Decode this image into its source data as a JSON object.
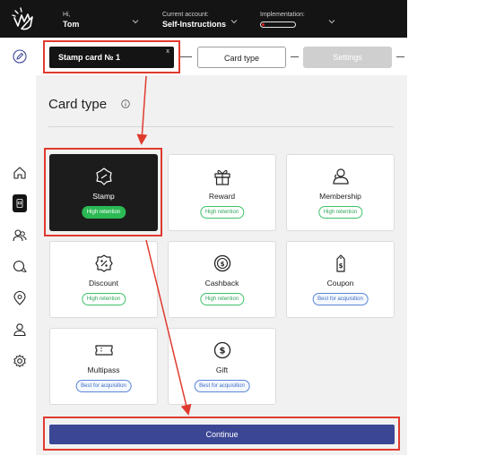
{
  "header": {
    "greeting_small": "Hi,",
    "user_name": "Tom",
    "account_label": "Current account:",
    "account_value": "Self-Instructions",
    "implementation_label": "Implementation:",
    "implementation_progress": 0.05
  },
  "subheader": {
    "card_name": "Stamp card № 1",
    "close_symbol": "x",
    "steps": [
      "Card type",
      "Settings"
    ]
  },
  "page": {
    "title": "Card type"
  },
  "cards": [
    {
      "name": "Stamp",
      "badge": "High retention",
      "badge_type": "green",
      "selected": true,
      "icon": "stamp-icon"
    },
    {
      "name": "Reward",
      "badge": "High retention",
      "badge_type": "green",
      "selected": false,
      "icon": "gift-icon"
    },
    {
      "name": "Membership",
      "badge": "High retention",
      "badge_type": "green",
      "selected": false,
      "icon": "membership-icon"
    },
    {
      "name": "Discount",
      "badge": "High retention",
      "badge_type": "green",
      "selected": false,
      "icon": "discount-icon"
    },
    {
      "name": "Cashback",
      "badge": "High retention",
      "badge_type": "green",
      "selected": false,
      "icon": "cashback-icon"
    },
    {
      "name": "Coupon",
      "badge": "Best for acquisition",
      "badge_type": "blue",
      "selected": false,
      "icon": "coupon-icon"
    },
    {
      "name": "Multipass",
      "badge": "Best for acquisition",
      "badge_type": "blue",
      "selected": false,
      "icon": "ticket-icon"
    },
    {
      "name": "Gift",
      "badge": "Best for acquisition",
      "badge_type": "blue",
      "selected": false,
      "icon": "dollar-icon"
    }
  ],
  "actions": {
    "continue_label": "Continue"
  },
  "colors": {
    "topbar": "#141414",
    "primary_button": "#3b4795",
    "highlight": "#e03a2f",
    "badge_green": "#2cb955",
    "badge_blue": "#5a86d8"
  }
}
